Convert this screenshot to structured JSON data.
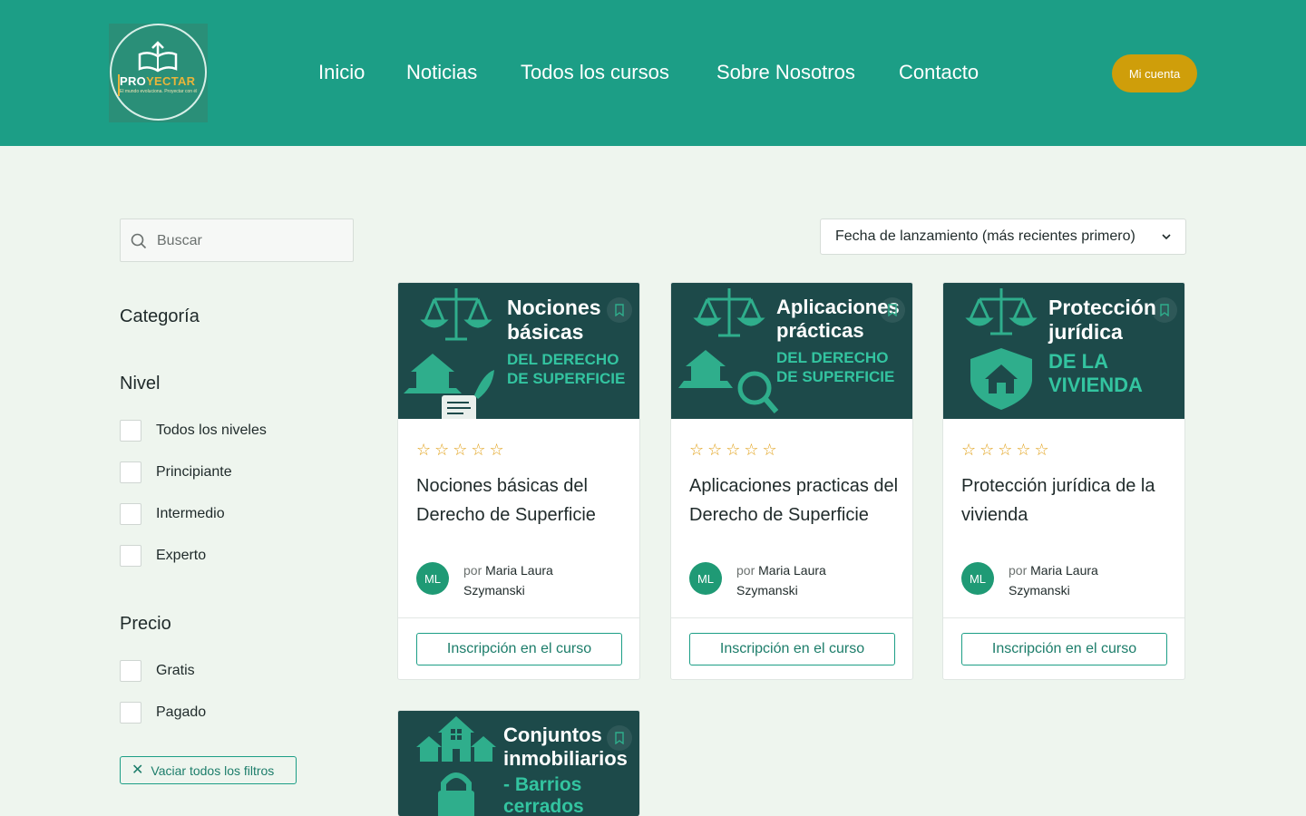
{
  "header": {
    "logo_brand_a": "PRO",
    "logo_brand_b": "YECTAR",
    "logo_tagline": "El mundo evoluciona. Proyectar con él",
    "nav": [
      "Inicio",
      "Noticias",
      "Todos los cursos",
      "Sobre Nosotros",
      "Contacto"
    ],
    "account_label": "Mi cuenta"
  },
  "search": {
    "placeholder": "Buscar"
  },
  "sort": {
    "selected": "Fecha de lanzamiento (más recientes primero)"
  },
  "filters": {
    "category_title": "Categoría",
    "level_title": "Nivel",
    "levels": [
      "Todos los niveles",
      "Principiante",
      "Intermedio",
      "Experto"
    ],
    "price_title": "Precio",
    "prices": [
      "Gratis",
      "Pagado"
    ],
    "clear_label": "Vaciar todos los filtros"
  },
  "courses": [
    {
      "thumb_line1": "Nociones",
      "thumb_line2": "básicas",
      "thumb_sub1": "DEL DERECHO",
      "thumb_sub2": "DE SUPERFICIE",
      "title": "Nociones básicas del Derecho de Superficie",
      "rating": 0,
      "author_initials": "ML",
      "by": "por",
      "author": "Maria Laura Szymanski",
      "enroll_label": "Inscripción en el curso"
    },
    {
      "thumb_line1": "Aplicaciones",
      "thumb_line2": "prácticas",
      "thumb_sub1": "DEL DERECHO",
      "thumb_sub2": "DE SUPERFICIE",
      "title": "Aplicaciones practicas del Derecho de Superficie",
      "rating": 0,
      "author_initials": "ML",
      "by": "por",
      "author": "Maria Laura Szymanski",
      "enroll_label": "Inscripción en el curso"
    },
    {
      "thumb_line1": "Protección",
      "thumb_line2": "jurídica",
      "thumb_sub1": "DE LA",
      "thumb_sub2": "VIVIENDA",
      "title": "Protección jurídica de la vivienda",
      "rating": 0,
      "author_initials": "ML",
      "by": "por",
      "author": "Maria Laura Szymanski",
      "enroll_label": "Inscripción en el curso"
    },
    {
      "thumb_line1": "Conjuntos",
      "thumb_line2": "inmobiliarios",
      "thumb_sub1": "- Barrios",
      "thumb_sub2": "cerrados"
    }
  ],
  "colors": {
    "header_bg": "#1c9e86",
    "page_bg": "#eef5ee",
    "accent_gold": "#cf9e0a",
    "thumb_bg": "#1d4a4a",
    "thumb_accent": "#33c4a0",
    "star": "#e2a21b"
  },
  "icons": [
    "search-icon",
    "chevron-down-icon",
    "bookmark-icon",
    "star-icon",
    "close-icon",
    "scale-icon",
    "house-icon"
  ]
}
